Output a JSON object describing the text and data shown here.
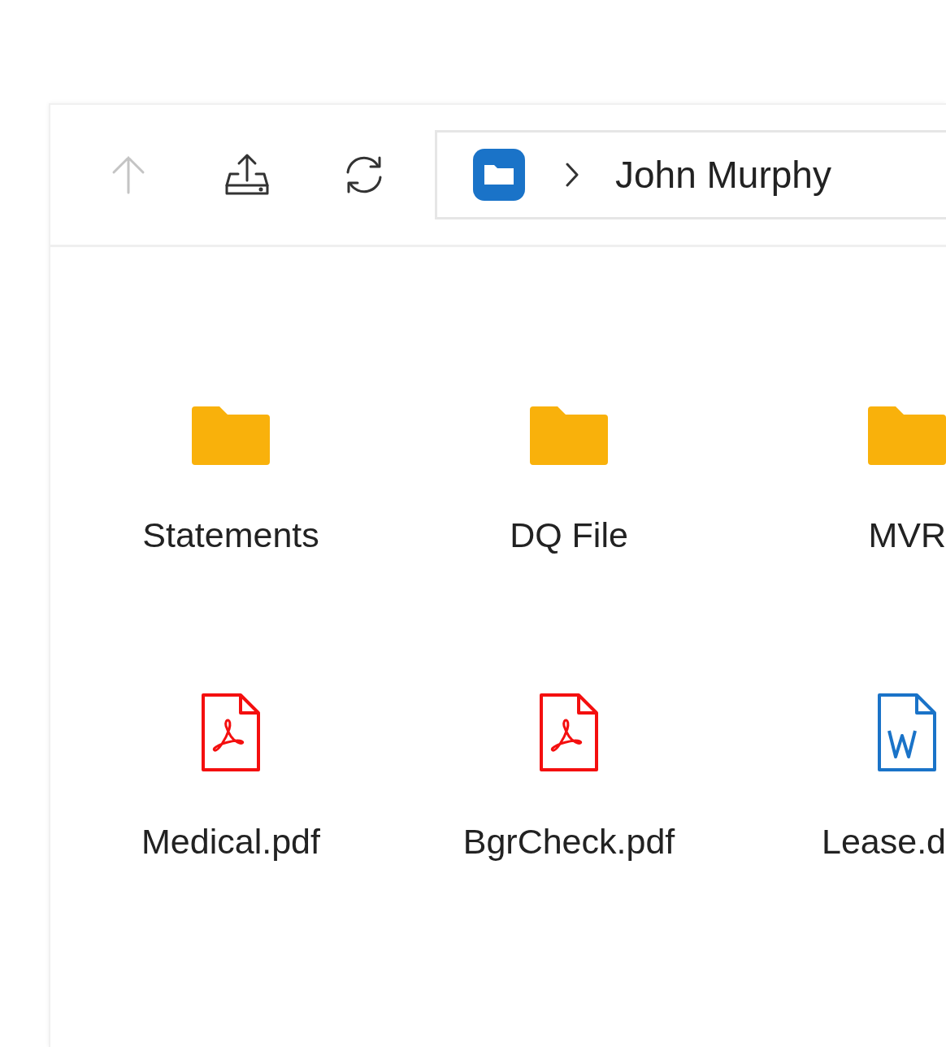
{
  "toolbar": {
    "buttons": [
      {
        "kind": "up",
        "disabled": true
      },
      {
        "kind": "upload",
        "disabled": false
      },
      {
        "kind": "refresh",
        "disabled": false
      }
    ]
  },
  "breadcrumb": {
    "items": [
      "John Murphy"
    ]
  },
  "files": [
    {
      "kind": "folder",
      "name": "Statements"
    },
    {
      "kind": "folder",
      "name": "DQ File"
    },
    {
      "kind": "folder",
      "name": "MVR"
    },
    {
      "kind": "pdf",
      "name": "Medical.pdf"
    },
    {
      "kind": "pdf",
      "name": "BgrCheck.pdf"
    },
    {
      "kind": "word",
      "name": "Lease.d"
    }
  ]
}
